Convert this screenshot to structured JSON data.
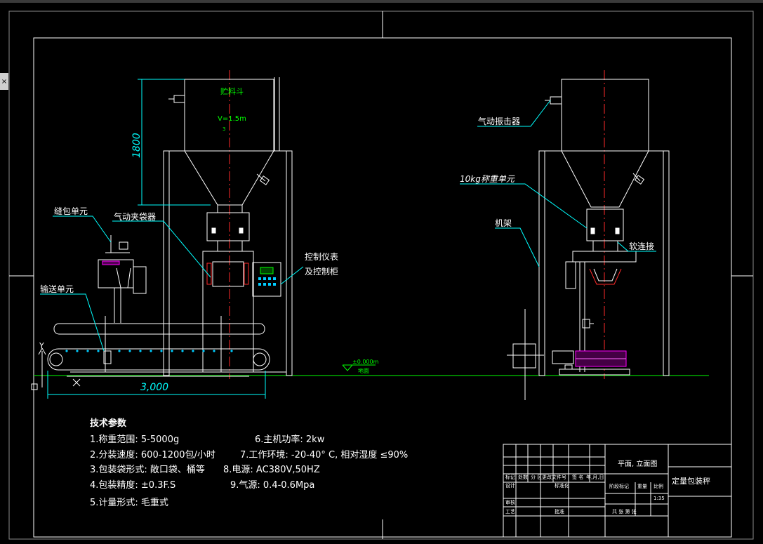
{
  "colors": {
    "background": "#000000",
    "line": "#ffffff",
    "dim": "#00ffff",
    "center": "#ff2a2a",
    "hopper_text": "#00ff00",
    "accent": "#ff00ff",
    "border_gray": "#8a8a8a"
  },
  "front_view": {
    "hopper_label": "贮料斗",
    "volume_label": "V=1.5m",
    "volume_exp": "3",
    "height_dim": "1800",
    "width_dim": "3,000",
    "callout_sewing": "缝包单元",
    "callout_clamp": "气动夹袋器",
    "callout_conveyor": "输送单元",
    "callout_control_1": "控制仪表",
    "callout_control_2": "及控制柜",
    "level_mark": "±0.000m",
    "ground_label": "地面",
    "axis_y": "Y"
  },
  "side_view": {
    "callout_vibrator": "气动振击器",
    "callout_weigh": "10kg称重单元",
    "callout_frame": "机架",
    "callout_soft": "软连接"
  },
  "specs": {
    "title": "技术参数",
    "left": [
      "1.称重范围: 5-5000g",
      "2.分装速度: 600-1200包/小时",
      "3.包装袋形式: 敞口袋、桶等",
      "4.包装精度: ±0.3F.S",
      "5.计量形式: 毛重式"
    ],
    "right": [
      "6.主机功率: 2kw",
      "7.工作环境: -20-40° C, 相对湿度 ≤90%",
      "8.电源: AC380V,50HZ",
      "9.气源: 0.4-0.6Mpa"
    ]
  },
  "title_block": {
    "view_name": "平面, 立面图",
    "product_name": "定量包装秤",
    "row_header": [
      "标记",
      "处数",
      "分 区",
      "更改文件号",
      "签 名",
      "年,月,日"
    ],
    "design": "设计",
    "standard": "标准化",
    "stage": "阶段标记",
    "weight": "重量",
    "scale_label": "比例",
    "scale_value": "1:35",
    "review": "审核",
    "process": "工艺",
    "approve": "批准",
    "sheets": "共   张   第   张"
  }
}
